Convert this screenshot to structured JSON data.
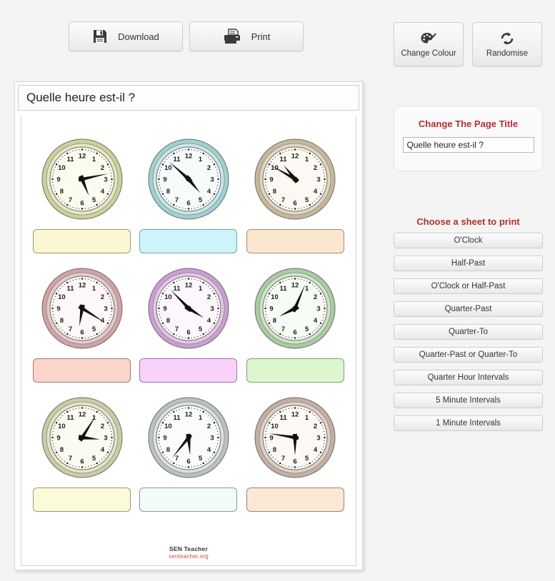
{
  "toolbar": {
    "download_label": "Download",
    "print_label": "Print",
    "change_colour_label": "Change Colour",
    "randomise_label": "Randomise"
  },
  "worksheet": {
    "title": "Quelle heure est-il ?",
    "footer_name": "SEN Teacher",
    "footer_url": "senteacher.org",
    "clocks": [
      {
        "id": "clock-1",
        "hour_angle": 158,
        "minute_angle": 78,
        "rim": "#cdcf9e",
        "rim_inner": "#e6e7c6",
        "face": "#fbfbef",
        "box": "#fbf7d3",
        "box_border": "#9a9a78"
      },
      {
        "id": "clock-2",
        "hour_angle": 140,
        "minute_angle": 312,
        "rim": "#9fd0d4",
        "rim_inner": "#c9e8ea",
        "face": "#f7fbfb",
        "box": "#cdf4fb",
        "box_border": "#6fa6ad"
      },
      {
        "id": "clock-3",
        "hour_angle": 321,
        "minute_angle": 300,
        "rim": "#c5b79e",
        "rim_inner": "#e0d6c4",
        "face": "#fbf9f2",
        "box": "#fbe6cf",
        "box_border": "#a08f76"
      },
      {
        "id": "clock-4",
        "hour_angle": 189,
        "minute_angle": 122,
        "rim": "#cfa3a8",
        "rim_inner": "#e7c9cd",
        "face": "#fdf7f7",
        "box": "#fad5cc",
        "box_border": "#a5787c"
      },
      {
        "id": "clock-5",
        "hour_angle": 122,
        "minute_angle": 316,
        "rim": "#ca9ed6",
        "rim_inner": "#e4c7ea",
        "face": "#fcf7fd",
        "box": "#f8d2fb",
        "box_border": "#9a74a4"
      },
      {
        "id": "clock-6",
        "hour_angle": 243,
        "minute_angle": 23,
        "rim": "#a9cba5",
        "rim_inner": "#cde5ca",
        "face": "#f8fcf7",
        "box": "#ddf6cf",
        "box_border": "#7ba077"
      },
      {
        "id": "clock-7",
        "hour_angle": 96,
        "minute_angle": 32,
        "rim": "#cbcba8",
        "rim_inner": "#e4e4ca",
        "face": "#fbfbf2",
        "box": "#fbfbd9",
        "box_border": "#9a9a78"
      },
      {
        "id": "clock-8",
        "hour_angle": 175,
        "minute_angle": 219,
        "rim": "#b9c2c2",
        "rim_inner": "#dce2e2",
        "face": "#fafcfc",
        "box": "#f1fbf8",
        "box_border": "#8d9a9a"
      },
      {
        "id": "clock-9",
        "hour_angle": 180,
        "minute_angle": 279,
        "rim": "#c4aea6",
        "rim_inner": "#ded0c9",
        "face": "#fdf9f6",
        "box": "#fbe8d5",
        "box_border": "#9a8379"
      }
    ],
    "hour_numbers": [
      "12",
      "1",
      "2",
      "3",
      "4",
      "5",
      "6",
      "7",
      "8",
      "9",
      "10",
      "11"
    ]
  },
  "panel": {
    "title_heading": "Change The Page Title",
    "title_value": "Quelle heure est-il ?",
    "title_placeholder": "Quelle heure est-il ?",
    "sheets_heading": "Choose a sheet to print",
    "sheet_buttons": [
      "O'Clock",
      "Half-Past",
      "O'Clock or Half-Past",
      "Quarter-Past",
      "Quarter-To",
      "Quarter-Past or Quarter-To",
      "Quarter Hour Intervals",
      "5 Minute Intervals",
      "1 Minute Intervals"
    ]
  },
  "colors": {
    "accent_red": "#b03030",
    "page_bg": "#f4f4f4"
  }
}
